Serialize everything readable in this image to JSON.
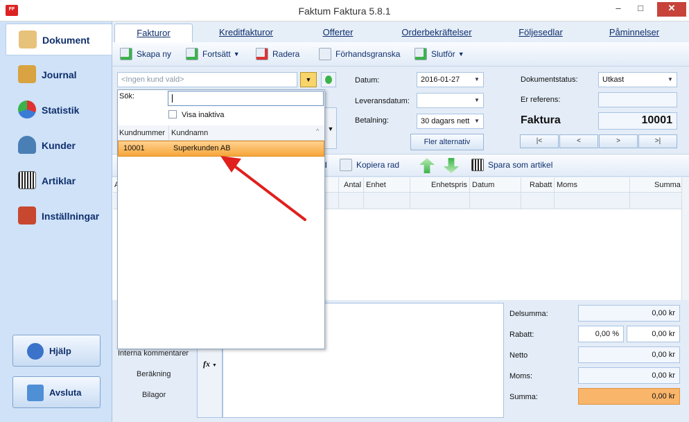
{
  "window": {
    "title": "Faktum Faktura 5.8.1",
    "app_icon": "FF",
    "minimize": "–",
    "maximize": "□",
    "close": "✕"
  },
  "nav": {
    "items": [
      {
        "label": "Dokument",
        "icon": "document-icon",
        "color": "#e7c27a"
      },
      {
        "label": "Journal",
        "icon": "journal-icon",
        "color": "#d8a340"
      },
      {
        "label": "Statistik",
        "icon": "pie-chart-icon",
        "color": "#3a7bd5"
      },
      {
        "label": "Kunder",
        "icon": "person-icon",
        "color": "#4a7fb5"
      },
      {
        "label": "Artiklar",
        "icon": "barcode-icon",
        "color": "#555555"
      },
      {
        "label": "Inställningar",
        "icon": "house-icon",
        "color": "#c8472f"
      }
    ],
    "help": "Hjälp",
    "exit": "Avsluta"
  },
  "tabs": [
    "Fakturor",
    "Kreditfakturor",
    "Offerter",
    "Orderbekräftelser",
    "Följesedlar",
    "Påminnelser"
  ],
  "toolbar": {
    "new": "Skapa ny",
    "continue": "Fortsätt",
    "delete": "Radera",
    "preview": "Förhandsgranska",
    "finish": "Slutför"
  },
  "customer": {
    "placeholder": "<Ingen kund vald>"
  },
  "form": {
    "date_label": "Datum:",
    "date": "2016-01-27",
    "delivery_label": "Leveransdatum:",
    "delivery": "",
    "payment_label": "Betalning:",
    "payment": "30 dagars nett",
    "more": "Fler alternativ",
    "status_label": "Dokumentstatus:",
    "status": "Utkast",
    "ref_label": "Er referens:",
    "ref": "",
    "doc_type": "Faktura",
    "doc_number": "10001"
  },
  "record_nav": [
    "|<",
    "<",
    ">",
    ">|"
  ],
  "items_toolbar": {
    "partial": "d",
    "copy": "Kopiera rad",
    "save": "Spara som artikel"
  },
  "grid": {
    "columns": [
      "A",
      "Antal",
      "Enhet",
      "Enhetspris",
      "Datum",
      "Rabatt",
      "Moms",
      "Summa"
    ]
  },
  "bottom": {
    "links": [
      "Interna kommentarer",
      "Beräkning",
      "Bilagor"
    ],
    "fx": "fx"
  },
  "totals": {
    "subtotal_label": "Delsumma:",
    "subtotal": "0,00 kr",
    "discount_label": "Rabatt:",
    "discount_pct": "0,00 %",
    "discount": "0,00 kr",
    "net_label": "Netto",
    "net": "0,00 kr",
    "vat_label": "Moms:",
    "vat": "0,00 kr",
    "sum_label": "Summa:",
    "sum": "0,00 kr"
  },
  "popup": {
    "search_label": "Sök:",
    "search_value": "",
    "inactive_label": "Visa inaktiva",
    "col_number": "Kundnummer",
    "col_name": "Kundnamn",
    "sort_glyph": "^",
    "row_number": "10001",
    "row_name": "Superkunden AB"
  },
  "colors": {
    "accent": "#f6a63a",
    "nav_bg": "#cfe2f8",
    "arrow": "#e0201c"
  }
}
